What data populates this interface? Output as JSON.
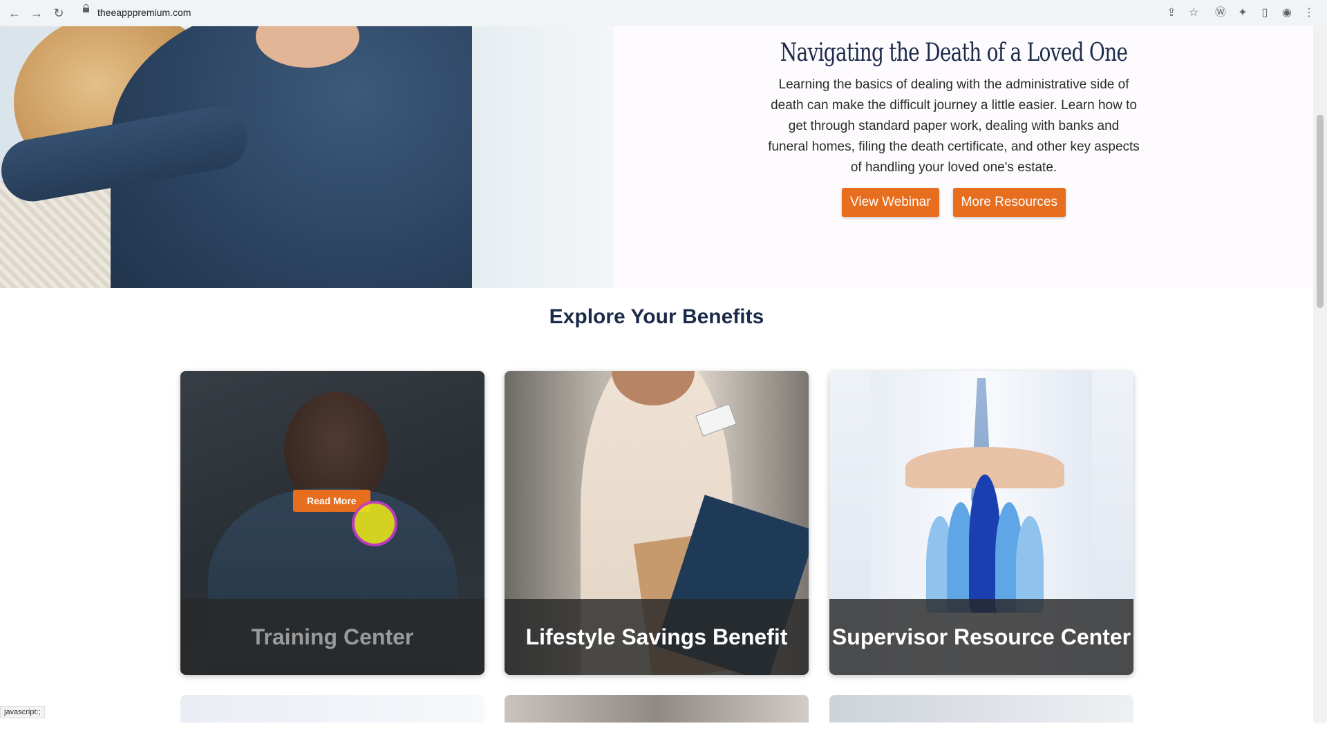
{
  "browser": {
    "url": "theeapppremium.com",
    "icons": [
      "back-icon",
      "forward-icon",
      "reload-icon",
      "lock-icon",
      "share-icon",
      "star-icon",
      "wordpress-icon",
      "extensions-icon",
      "sidepanel-icon",
      "profile-icon",
      "menu-icon"
    ]
  },
  "hero": {
    "title": "Navigating the Death of a Loved One",
    "body": "Learning the basics of dealing with the administrative side of death can make the difficult journey a little easier. Learn how to get through standard paper work, dealing with banks and funeral homes, filing the death certificate, and other key aspects of handling your loved one's estate.",
    "view_webinar": "View Webinar",
    "more_resources": "More Resources"
  },
  "benefits": {
    "title": "Explore Your Benefits",
    "cards": [
      {
        "label": "Training Center",
        "button": "Read More"
      },
      {
        "label": "Lifestyle Savings Benefit"
      },
      {
        "label": "Supervisor Resource Center"
      }
    ]
  },
  "status_bar": {
    "text": "javascript:;"
  },
  "colors": {
    "accent": "#e76e1e",
    "heading": "#1d2b4a"
  }
}
